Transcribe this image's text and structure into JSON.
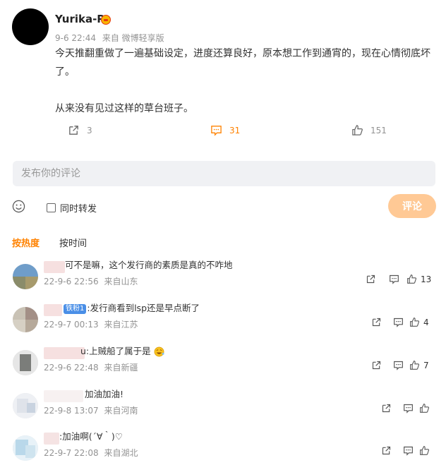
{
  "post": {
    "username": "Yurika-R",
    "date": "9-6 22:44",
    "source": "来自 微博轻享版",
    "content_line1": "今天推翻重做了一遍基础设定，进度还算良好，原本想工作到通宵的，现在心情彻底坏",
    "content_line2": "了。",
    "content_line3": "从来没有见过这样的草台班子。",
    "repost_count": "3",
    "comment_count": "31",
    "like_count": "151"
  },
  "composer": {
    "placeholder": "发布你的评论",
    "forward_label": "同时转发",
    "submit_label": "评论"
  },
  "sort": {
    "hot": "按热度",
    "time": "按时间"
  },
  "comments": [
    {
      "text": "可不是嘛，这个发行商的素质是真的不咋地",
      "date": "22-9-6 22:56",
      "location": "来自山东",
      "likes": "13"
    },
    {
      "tag": "铁粉1",
      "text": ":发行商看到lsp还是早点断了",
      "date": "22-9-7 00:13",
      "location": "来自江苏",
      "likes": "4"
    },
    {
      "text": "u:上贼船了属于是",
      "date": "22-9-6 22:48",
      "location": "来自新疆",
      "likes": "7"
    },
    {
      "text": "加油加油!",
      "date": "22-9-8 13:07",
      "location": "来自河南",
      "likes": ""
    },
    {
      "text": ":加油啊(´∀｀)♡",
      "date": "22-9-7 22:08",
      "location": "来自湖北",
      "likes": ""
    }
  ],
  "colors": {
    "accent": "#ff8200",
    "meta": "#939393",
    "submit_bg": "#ffc995"
  }
}
